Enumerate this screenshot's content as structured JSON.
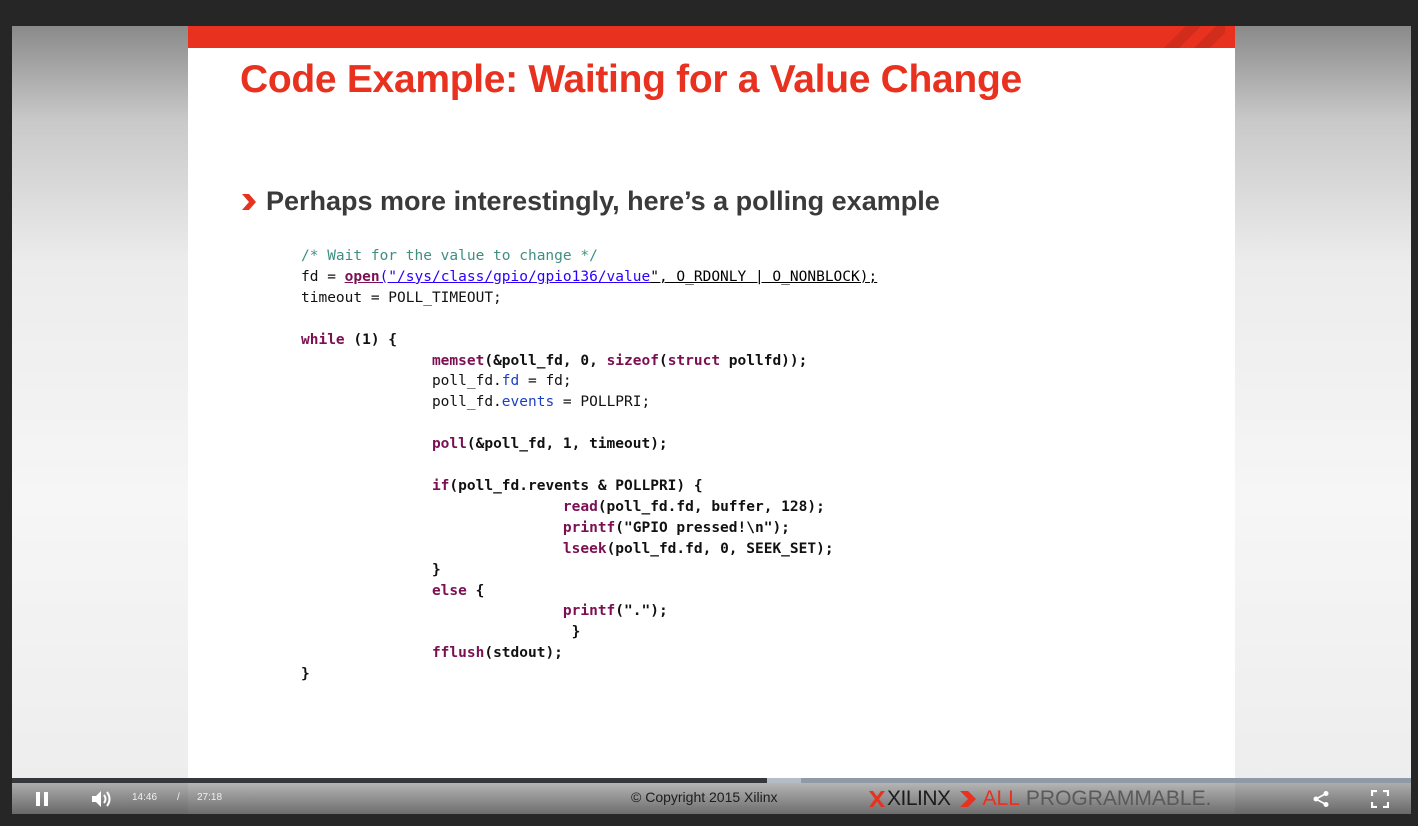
{
  "slide": {
    "title": "Code Example: Waiting for a Value Change",
    "bullet": "Perhaps more interestingly, here’s a polling example",
    "code": {
      "comment": "/* Wait for the value to change */",
      "fd_assign": "fd = ",
      "open_fn": "open",
      "open_paren": "(\"",
      "path": "/sys/class/gpio/gpio136/value",
      "open_rest": "\", O_RDONLY | O_NONBLOCK);",
      "timeout_line": "timeout = POLL_TIMEOUT;",
      "while_kw": "while",
      "while_rest": " (1) {",
      "memset_fn": "memset",
      "memset_args_a": "(&poll_fd, 0, ",
      "sizeof_kw": "sizeof",
      "memset_args_b": "(",
      "struct_kw": "struct",
      "memset_args_c": " pollfd));",
      "pfd_a": "poll_fd.",
      "fd_field": "fd",
      "pfd_a_rest": " = fd;",
      "pfd_b": "poll_fd.",
      "events_field": "events",
      "pfd_b_rest": " = POLLPRI;",
      "poll_fn": "poll",
      "poll_args": "(&poll_fd, 1, timeout);",
      "if_kw": "if",
      "if_a": "(poll_fd.",
      "revents_field": "revents",
      "if_rest": " & POLLPRI) {",
      "read_fn": "read",
      "read_a": "(poll_fd.",
      "read_fd": "fd",
      "read_rest": ", buffer, 128);",
      "printf1_fn": "printf",
      "printf1_open": "(",
      "printf1_str": "\"GPIO pressed!\\n\"",
      "printf1_close": ");",
      "lseek_fn": "lseek",
      "lseek_a": "(poll_fd.",
      "lseek_fd": "fd",
      "lseek_rest": ", 0, SEEK_SET);",
      "close_if": "}",
      "else_kw": "else",
      "else_rest": " {",
      "printf2_fn": "printf",
      "printf2_open": "(",
      "printf2_str": "\".\"",
      "printf2_close": ");",
      "close_else": "}",
      "fflush_fn": "fflush",
      "fflush_args": "(stdout);",
      "close_while": "}"
    },
    "copyright": "© Copyright 2015 Xilinx",
    "brand": {
      "name": "XILINX",
      "tag_all": "ALL",
      "tag_prog": "PROGRAMMABLE."
    },
    "colors": {
      "accent": "#e8311f",
      "keyword": "#7b0f52",
      "string": "#2a00ff",
      "comment": "#3f8f7f"
    }
  },
  "player": {
    "current_time": "14:46",
    "separator": "/",
    "duration": "27:18",
    "played_fraction": 0.54,
    "buffered_fraction": 0.564,
    "icons": [
      "pause-icon",
      "volume-icon",
      "share-icon",
      "fullscreen-icon"
    ]
  }
}
